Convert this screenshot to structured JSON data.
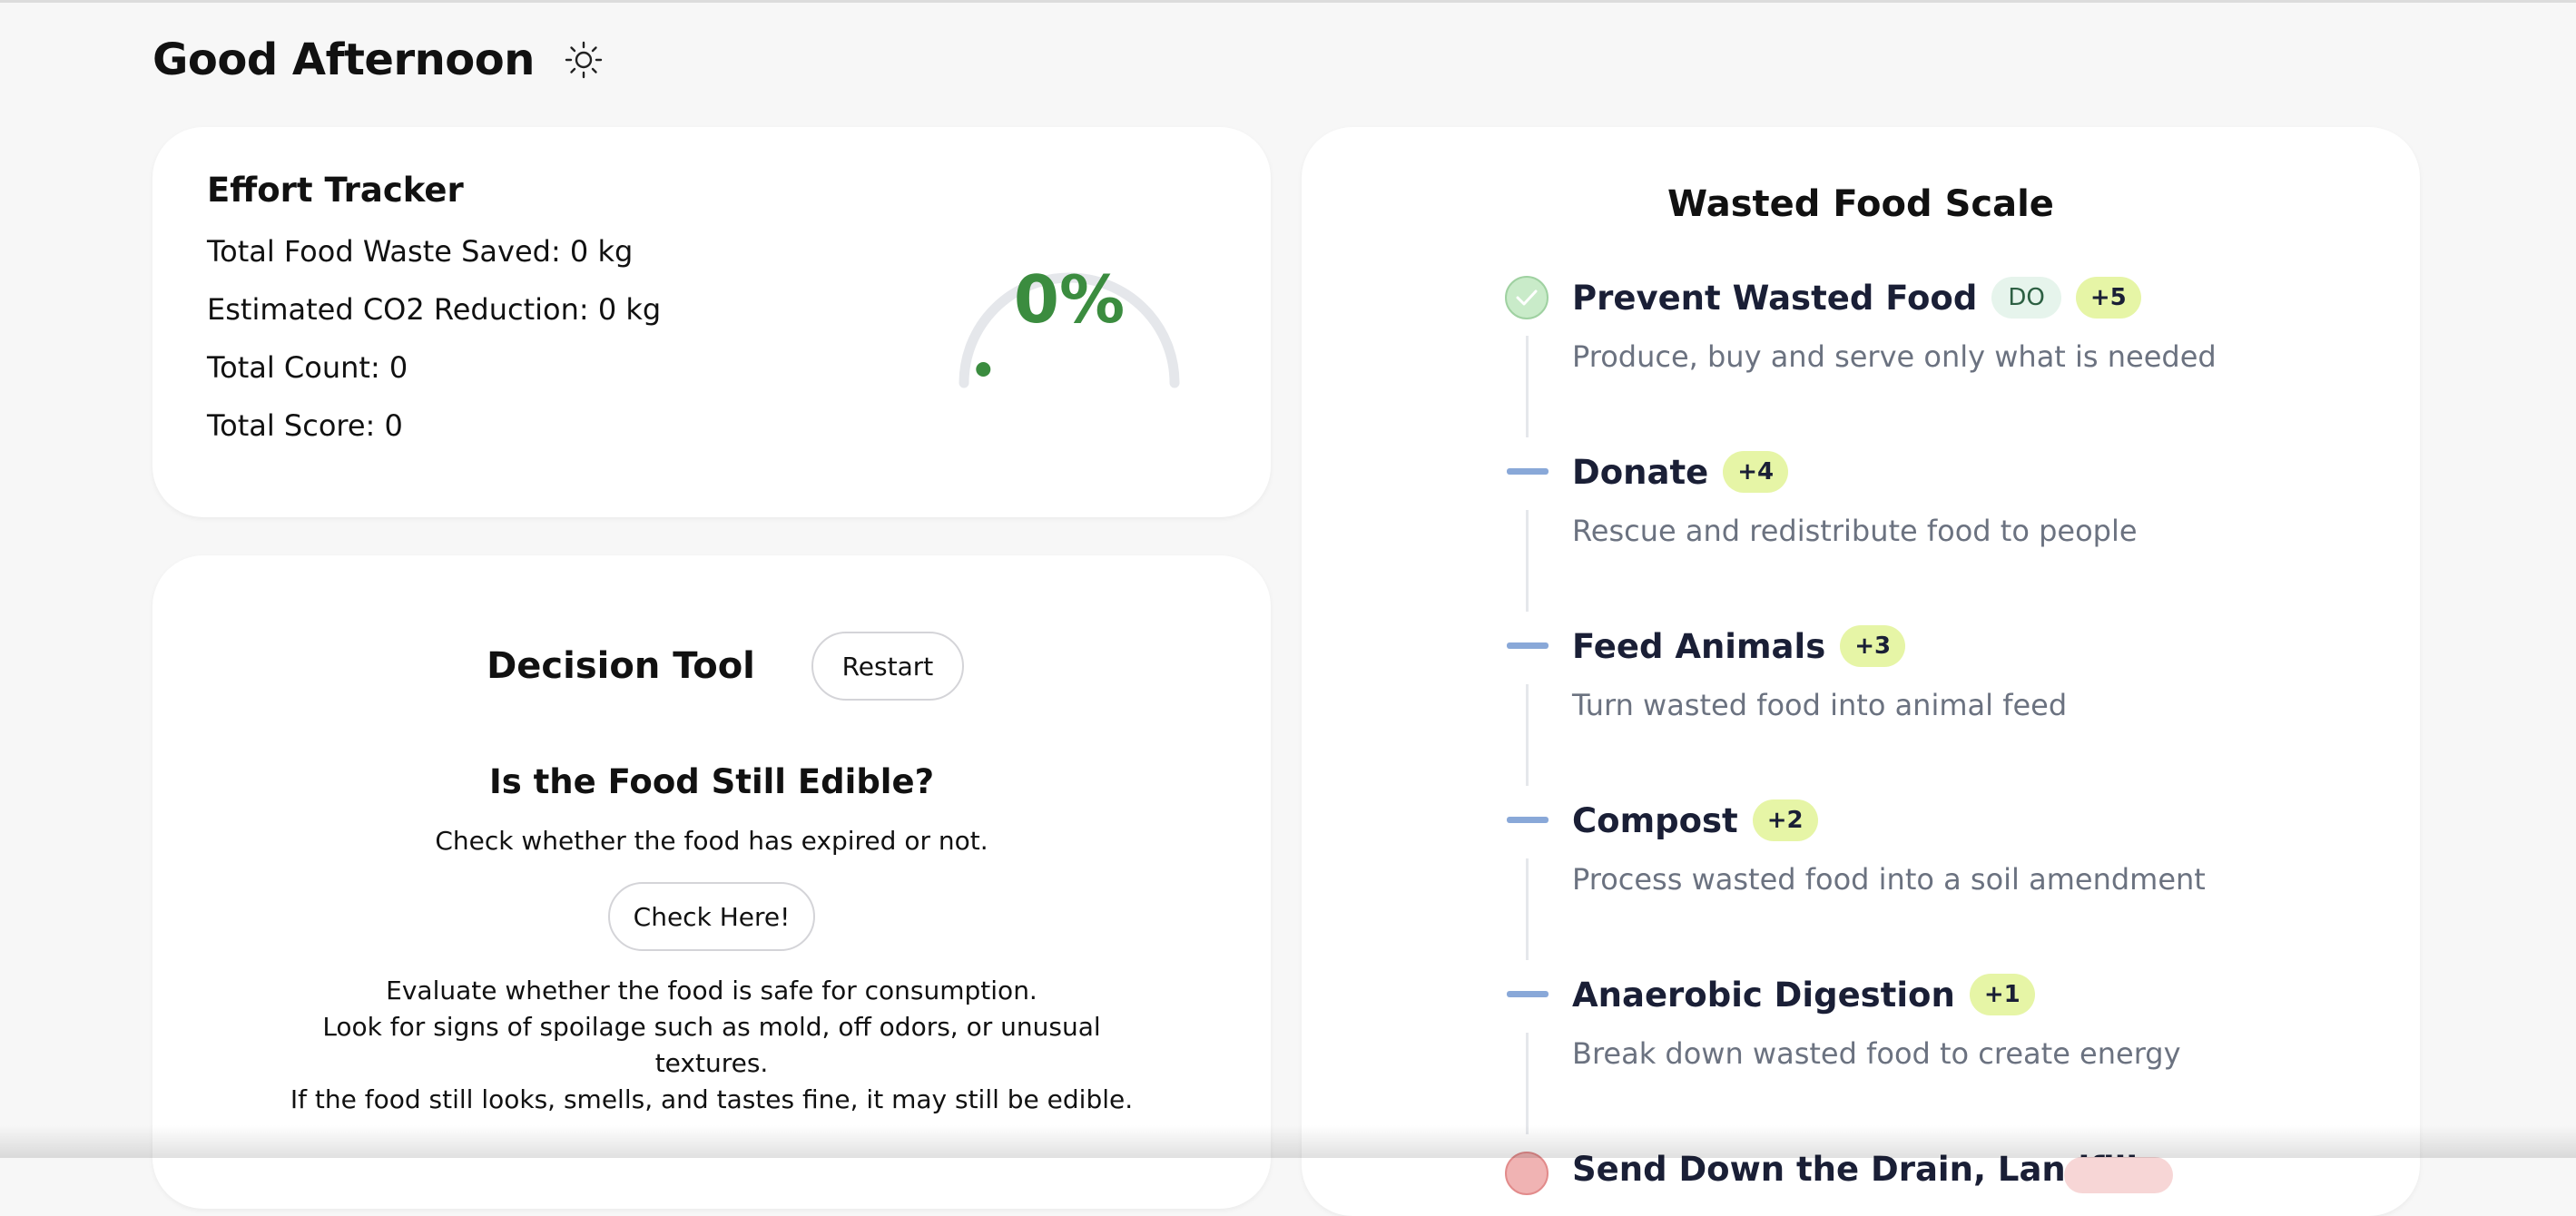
{
  "greeting": {
    "text": "Good Afternoon",
    "theme_icon": "sun-icon"
  },
  "effort_tracker": {
    "title": "Effort Tracker",
    "total_food_waste_saved": "Total Food Waste Saved: 0 kg",
    "estimated_co2_reduction": "Estimated CO2 Reduction: 0 kg",
    "total_count": "Total Count: 0",
    "total_score": "Total Score: 0",
    "progress_percent": 0,
    "progress_label": "0%",
    "progress_color": "#3b8c3f"
  },
  "decision_tool": {
    "title": "Decision Tool",
    "restart_label": "Restart",
    "question_title": "Is the Food Still Edible?",
    "question_subtitle": "Check whether the food has expired or not.",
    "check_label": "Check Here!",
    "evaluate_line1": "Evaluate whether the food is safe for consumption.",
    "evaluate_line2": "Look for signs of spoilage such as mold, off odors, or unusual textures.",
    "evaluate_line3": "If the food still looks, smells, and tastes fine, it may still be edible."
  },
  "wasted_food_scale": {
    "title": "Wasted Food Scale",
    "items": [
      {
        "name": "Prevent Wasted Food",
        "tag": "DO",
        "points": "+5",
        "description": "Produce, buy and serve only what is needed",
        "status_icon": "check-circle-icon"
      },
      {
        "name": "Donate",
        "points": "+4",
        "description": "Rescue and redistribute food to people",
        "status_icon": "dash-icon"
      },
      {
        "name": "Feed Animals",
        "points": "+3",
        "description": "Turn wasted food into animal feed",
        "status_icon": "dash-icon"
      },
      {
        "name": "Compost",
        "points": "+2",
        "description": "Process wasted food into a soil amendment",
        "status_icon": "dash-icon"
      },
      {
        "name": "Anaerobic Digestion",
        "points": "+1",
        "description": "Break down wasted food to create energy",
        "status_icon": "dash-icon"
      }
    ],
    "last_item": {
      "name": "Send Down the Drain, Landfill",
      "status_icon": "x-circle-icon"
    }
  }
}
